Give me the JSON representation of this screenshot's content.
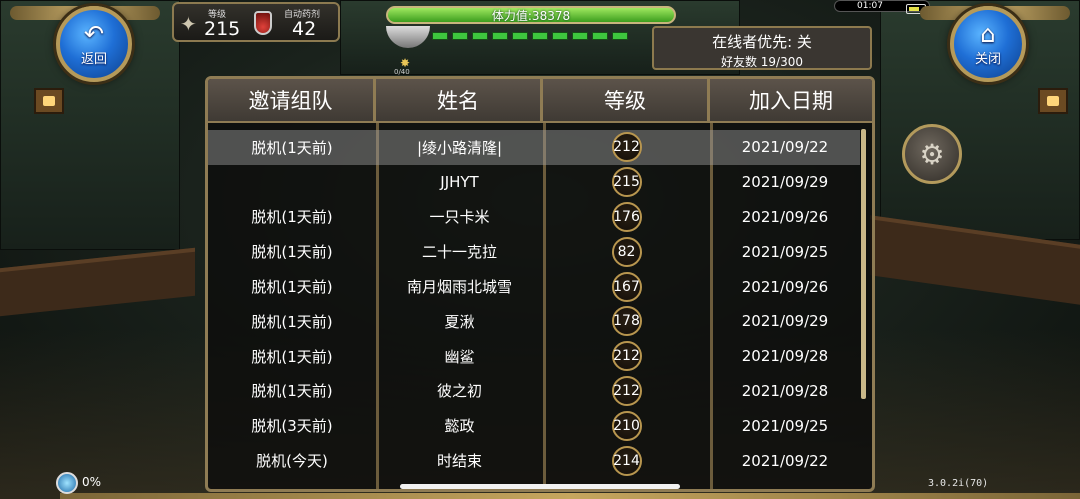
{
  "nav": {
    "back": {
      "label": "返回",
      "icon": "return-arrow-icon"
    },
    "close": {
      "label": "关闭",
      "icon": "home-icon"
    }
  },
  "status": {
    "level_label": "等级",
    "level_value": "215",
    "potion_label": "自动药剂",
    "potion_value": "42",
    "hp_text": "体力值:38378",
    "star_text": "0/40"
  },
  "system": {
    "clock": "01:07"
  },
  "online": {
    "priority_text": "在线者优先: 关",
    "friend_count": "好友数 19/300"
  },
  "table": {
    "headers": [
      "邀请组队",
      "姓名",
      "等级",
      "加入日期"
    ],
    "rows": [
      {
        "status": "脱机(1天前)",
        "name": "|绫小路清隆|",
        "level": "212",
        "date": "2021/09/22"
      },
      {
        "status": "",
        "name": "JJHYT",
        "level": "215",
        "date": "2021/09/29"
      },
      {
        "status": "脱机(1天前)",
        "name": "一只卡米",
        "level": "176",
        "date": "2021/09/26"
      },
      {
        "status": "脱机(1天前)",
        "name": "二十一克拉",
        "level": "82",
        "date": "2021/09/25"
      },
      {
        "status": "脱机(1天前)",
        "name": "南月烟雨北城雪",
        "level": "167",
        "date": "2021/09/26"
      },
      {
        "status": "脱机(1天前)",
        "name": "夏湫",
        "level": "178",
        "date": "2021/09/29"
      },
      {
        "status": "脱机(1天前)",
        "name": "幽鲨",
        "level": "212",
        "date": "2021/09/28"
      },
      {
        "status": "脱机(1天前)",
        "name": "彼之初",
        "level": "212",
        "date": "2021/09/28"
      },
      {
        "status": "脱机(3天前)",
        "name": "懿政",
        "level": "210",
        "date": "2021/09/25"
      },
      {
        "status": "脱机(今天)",
        "name": "时结束",
        "level": "214",
        "date": "2021/09/22"
      }
    ]
  },
  "footer": {
    "load_percent": "0%",
    "version": "3.0.2i(70)"
  },
  "colors": {
    "accent_gold": "#b8964f",
    "button_blue": "#1f6fd6",
    "hp_green": "#3c9e1e"
  }
}
